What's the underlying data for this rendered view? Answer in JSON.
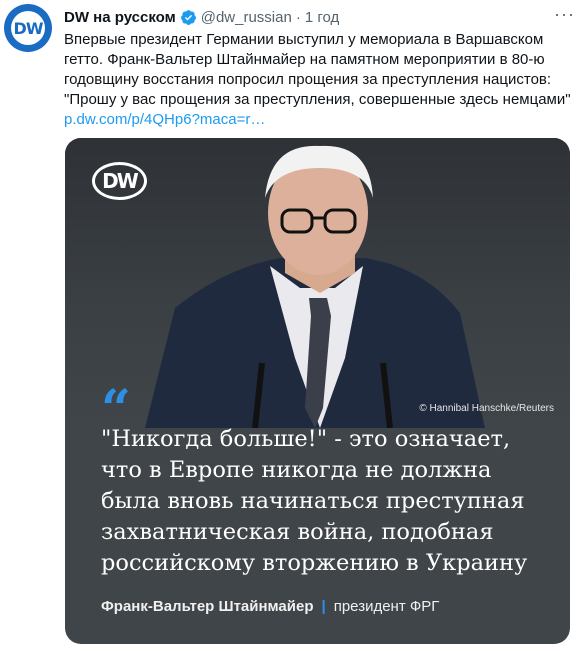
{
  "tweet": {
    "author_name": "DW на русском",
    "handle": "@dw_russian",
    "separator": "·",
    "time": "1 год",
    "more_icon": "more-dots-icon",
    "avatar_text": "DW",
    "text": "Впервые президент Германии выступил у мемориала в Варшавском гетто. Франк-Вальтер Штайнмайер на памятном мероприятии в 80-ю годовщину восстания попросил прощения за преступления нацистов: \"Прошу у вас прощения за преступления, совершенные здесь немцами\" ",
    "link": "p.dw.com/p/4QHp6?maca=r…"
  },
  "card": {
    "logo_text": "DW",
    "photo_credit": "© Hannibal Hanschke/Reuters",
    "quote_mark": "“",
    "quote_lines": [
      "\"Никогда больше!\" - это означает,",
      "что в Европе никогда не должна",
      "была вновь начинаться преступная",
      "захватническая война, подобная",
      "российскому вторжению в Украину"
    ],
    "attribution_name": "Франк-Вальтер Штайнмайер",
    "attribution_divider": "|",
    "attribution_role": "президент ФРГ"
  },
  "colors": {
    "link": "#1d9bf0",
    "dw_blue": "#1a6bc2",
    "card_bg": "#3f4548",
    "quote_accent": "#2d8fe6"
  }
}
